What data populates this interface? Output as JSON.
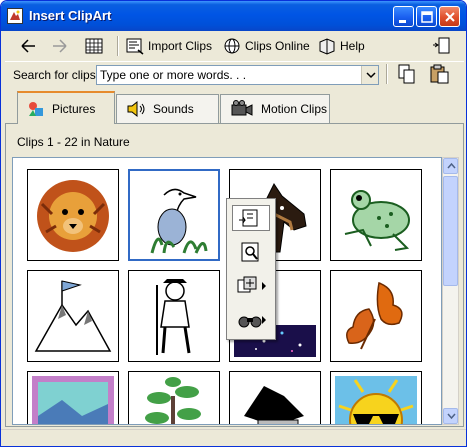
{
  "window": {
    "title": "Insert ClipArt"
  },
  "toolbar": {
    "import_label": "Import Clips",
    "online_label": "Clips Online",
    "help_label": "Help"
  },
  "search": {
    "label": "Search for clips:",
    "value": "Type one or more words. . ."
  },
  "tabs": [
    {
      "label": "Pictures",
      "active": true,
      "icon": "pictures-icon"
    },
    {
      "label": "Sounds",
      "active": false,
      "icon": "sound-speaker-icon"
    },
    {
      "label": "Motion Clips",
      "active": false,
      "icon": "film-camera-icon"
    }
  ],
  "clips_info": "Clips 1 - 22 in Nature",
  "clips": [
    {
      "name": "lion",
      "selected": false
    },
    {
      "name": "heron",
      "selected": true
    },
    {
      "name": "horse",
      "selected": false
    },
    {
      "name": "frog",
      "selected": false
    },
    {
      "name": "mountain-flag",
      "selected": false
    },
    {
      "name": "hiker",
      "selected": false
    },
    {
      "name": "night-sky",
      "selected": false
    },
    {
      "name": "oak-leaves",
      "selected": false
    },
    {
      "name": "landscape-painting",
      "selected": false
    },
    {
      "name": "tree",
      "selected": false
    },
    {
      "name": "dark-landscape",
      "selected": false
    },
    {
      "name": "sun-sunglasses",
      "selected": false
    }
  ],
  "popup_menu": [
    {
      "icon": "insert-clip-icon",
      "submenu": false
    },
    {
      "icon": "preview-clip-icon",
      "submenu": false
    },
    {
      "icon": "add-to-favorites-icon",
      "submenu": true
    },
    {
      "icon": "find-similar-icon",
      "submenu": true
    }
  ],
  "colors": {
    "titlebar": "#0055e5",
    "tab_accent": "#e68b2c",
    "selection": "#316ac5",
    "close_button": "#e0502c"
  }
}
